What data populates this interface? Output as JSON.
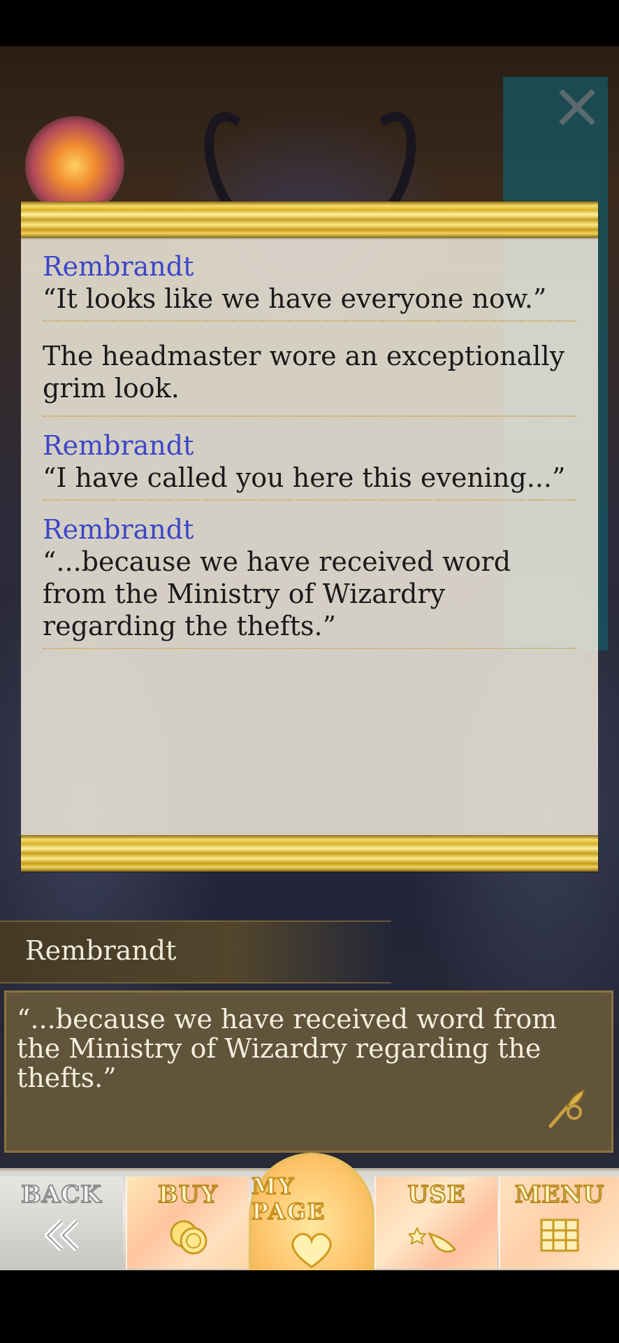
{
  "backlog": {
    "entries": [
      {
        "speaker": "Rembrandt",
        "text": "“It looks like we have everyone now.”"
      },
      {
        "speaker": "",
        "text": "The headmaster wore an exceptionally grim look."
      },
      {
        "speaker": "Rembrandt",
        "text": "“I have called you here this evening...”"
      },
      {
        "speaker": "Rembrandt",
        "text": "“...because we have received word from the Ministry of Wizardry regarding the thefts.”"
      }
    ]
  },
  "dialogue": {
    "speaker": "Rembrandt",
    "text": "“...because we have received word from the Ministry of Wizardry regarding the thefts.”"
  },
  "nav": {
    "back": "BACK",
    "buy": "BUY",
    "my_page": "MY PAGE",
    "use": "USE",
    "menu": "MENU"
  },
  "icons": {
    "close": "close-icon",
    "quill": "quill-icon",
    "back": "double-chevron-left-icon",
    "buy": "coins-icon",
    "my_page": "heart-icon",
    "use": "wand-icon",
    "menu": "grid-icon"
  },
  "colors": {
    "speaker_name": "#3b46c8",
    "gold_accent": "#d8b22a",
    "side_menu": "#165864"
  }
}
